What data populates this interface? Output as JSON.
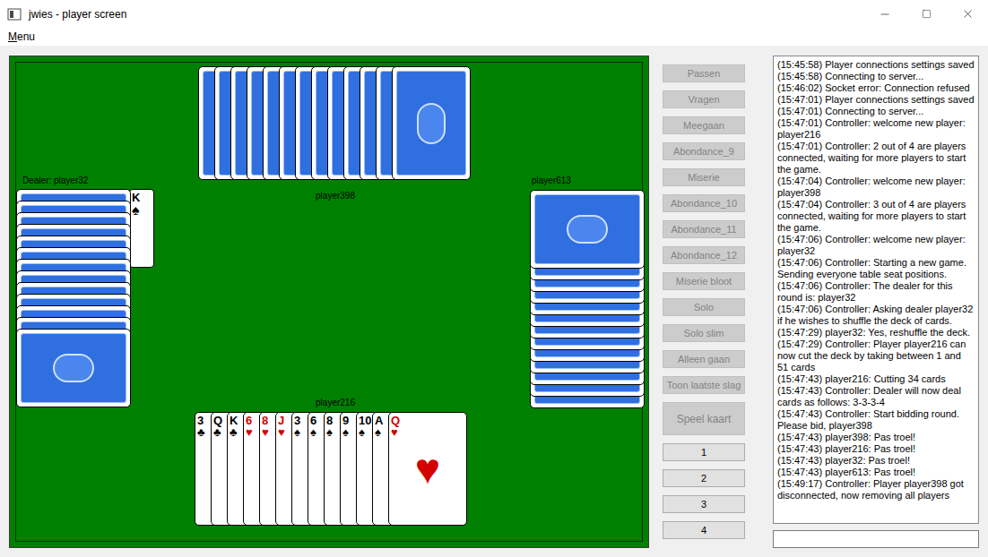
{
  "window": {
    "title": "jwies - player screen"
  },
  "menu": [
    {
      "label": "Menu"
    }
  ],
  "table": {
    "top": {
      "label": "player398",
      "card_backs": 13
    },
    "left": {
      "label": "Dealer: player32",
      "card_backs": 13,
      "played_card": {
        "rank": "K",
        "suit": "♠",
        "color": "#000000"
      }
    },
    "right": {
      "label": "player613",
      "card_backs": 13
    },
    "bottom": {
      "label": "player216",
      "cards": [
        {
          "rank": "3",
          "suit": "♣",
          "color": "#000000"
        },
        {
          "rank": "Q",
          "suit": "♣",
          "color": "#000000"
        },
        {
          "rank": "K",
          "suit": "♣",
          "color": "#000000"
        },
        {
          "rank": "6",
          "suit": "♥",
          "color": "#d40000"
        },
        {
          "rank": "8",
          "suit": "♥",
          "color": "#d40000"
        },
        {
          "rank": "J",
          "suit": "♥",
          "color": "#d40000"
        },
        {
          "rank": "3",
          "suit": "♠",
          "color": "#000000"
        },
        {
          "rank": "6",
          "suit": "♠",
          "color": "#000000"
        },
        {
          "rank": "8",
          "suit": "♠",
          "color": "#000000"
        },
        {
          "rank": "9",
          "suit": "♠",
          "color": "#000000"
        },
        {
          "rank": "10",
          "suit": "♠",
          "color": "#000000"
        },
        {
          "rank": "A",
          "suit": "♠",
          "color": "#000000"
        },
        {
          "rank": "Q",
          "suit": "♥",
          "color": "#d40000"
        }
      ]
    }
  },
  "buttons": [
    {
      "label": "Passen",
      "disabled": true,
      "kind": "normal"
    },
    {
      "label": "Vragen",
      "disabled": true,
      "kind": "normal"
    },
    {
      "label": "Meegaan",
      "disabled": true,
      "kind": "normal"
    },
    {
      "label": "Abondance_9",
      "disabled": true,
      "kind": "normal"
    },
    {
      "label": "Miserie",
      "disabled": true,
      "kind": "normal"
    },
    {
      "label": "Abondance_10",
      "disabled": true,
      "kind": "normal"
    },
    {
      "label": "Abondance_11",
      "disabled": true,
      "kind": "normal"
    },
    {
      "label": "Abondance_12",
      "disabled": true,
      "kind": "normal"
    },
    {
      "label": "Miserie bloot",
      "disabled": true,
      "kind": "normal"
    },
    {
      "label": "Solo",
      "disabled": true,
      "kind": "normal"
    },
    {
      "label": "Solo slim",
      "disabled": true,
      "kind": "normal"
    },
    {
      "label": "Alleen gaan",
      "disabled": true,
      "kind": "normal"
    },
    {
      "label": "Toon laatste slag",
      "disabled": true,
      "kind": "normal"
    },
    {
      "label": "Speel kaart",
      "disabled": true,
      "kind": "large"
    },
    {
      "label": "1",
      "disabled": false,
      "kind": "normal"
    },
    {
      "label": "2",
      "disabled": false,
      "kind": "normal"
    },
    {
      "label": "3",
      "disabled": false,
      "kind": "normal"
    },
    {
      "label": "4",
      "disabled": false,
      "kind": "normal"
    }
  ],
  "log": [
    "(15:45:58) Player connections settings saved",
    "(15:45:58) Connecting to server...",
    "(15:46:02) Socket error: Connection refused",
    "(15:47:01) Player connections settings saved",
    "(15:47:01) Connecting to server...",
    "(15:47:01) Controller: welcome new player: player216",
    "(15:47:01) Controller: 2 out of 4 are players connected, waiting for more players to start the game.",
    "(15:47:04) Controller: welcome new player: player398",
    "(15:47:04) Controller: 3 out of 4 are players connected, waiting for more players to start the game.",
    "(15:47:06) Controller: welcome new player: player32",
    "(15:47:06) Controller: Starting a new game. Sending everyone table seat positions.",
    "(15:47:06) Controller: The dealer for this round is: player32",
    "(15:47:06) Controller: Asking dealer player32 if he wishes to shuffle the deck of cards.",
    "(15:47:29) player32: Yes, reshuffle the deck.",
    "(15:47:29) Controller: Player player216 can now cut the deck by taking between 1 and 51 cards",
    "(15:47:43) player216: Cutting 34 cards",
    "(15:47:43) Controller: Dealer will now deal cards as follows: 3-3-3-4",
    "(15:47:43) Controller: Start bidding round. Please bid, player398",
    "(15:47:43) player398: Pas troel!",
    "(15:47:43) player216: Pas troel!",
    "(15:47:43) player32: Pas troel!",
    "(15:47:43) player613: Pas troel!",
    "(15:49:17) Controller: Player player398 got disconnected, now removing all players"
  ],
  "chat_input": {
    "value": ""
  }
}
